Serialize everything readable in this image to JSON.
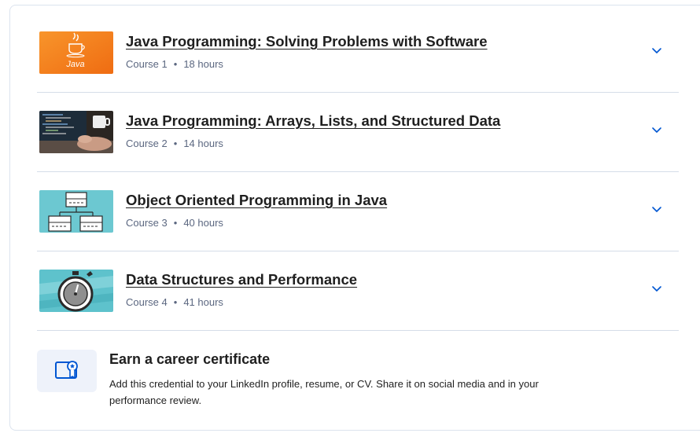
{
  "courses": [
    {
      "title": "Java Programming: Solving Problems with Software",
      "course_label": "Course 1",
      "duration": "18 hours",
      "thumbnail_icon": "java-logo-icon"
    },
    {
      "title": "Java Programming: Arrays, Lists, and Structured Data",
      "course_label": "Course 2",
      "duration": "14 hours",
      "thumbnail_icon": "laptop-typing-photo"
    },
    {
      "title": "Object Oriented Programming in Java",
      "course_label": "Course 3",
      "duration": "40 hours",
      "thumbnail_icon": "class-diagram-icon"
    },
    {
      "title": "Data Structures and Performance",
      "course_label": "Course 4",
      "duration": "41 hours",
      "thumbnail_icon": "stopwatch-icon"
    }
  ],
  "meta_separator": "•",
  "expand_icon": "chevron-down-icon",
  "certificate": {
    "title": "Earn a career certificate",
    "description": "Add this credential to your LinkedIn profile, resume, or CV. Share it on social media and in your performance review.",
    "icon": "certificate-icon"
  },
  "colors": {
    "accent": "#0056d2",
    "divider": "#d5dde8",
    "meta_text": "#5b6780",
    "java_orange": "#f47b20",
    "teal": "#5ec2cc"
  },
  "java_logo_text": "Java"
}
